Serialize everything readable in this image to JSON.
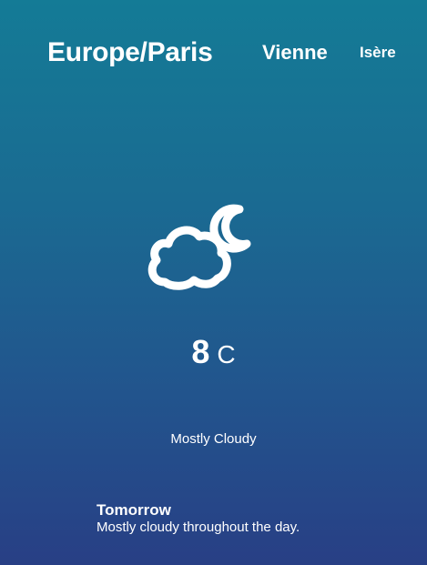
{
  "header": {
    "timezone": "Europe/Paris",
    "city": "Vienne",
    "region": "Isère"
  },
  "current": {
    "icon": "partly-cloudy-night-icon",
    "temperature": "8",
    "unit": "C",
    "condition": "Mostly Cloudy"
  },
  "forecast": {
    "title": "Tomorrow",
    "summary": "Mostly cloudy throughout the day."
  },
  "colors": {
    "gradient_top": "#147b96",
    "gradient_bottom": "#283f85",
    "text": "#ffffff"
  }
}
